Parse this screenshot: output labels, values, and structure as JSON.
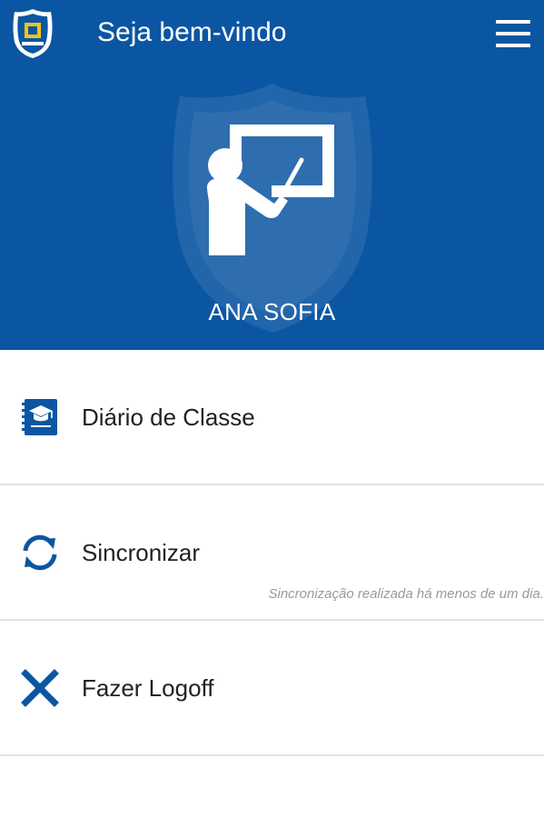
{
  "header": {
    "title": "Seja bem-vindo",
    "logo_icon": "school-shield-logo-icon",
    "menu_icon": "hamburger-menu-icon"
  },
  "profile": {
    "name": "ANA SOFIA",
    "avatar_icon": "teacher-at-board-icon",
    "watermark_icon": "shield-watermark-icon"
  },
  "menu": {
    "items": [
      {
        "label": "Diário de Classe",
        "icon": "class-diary-book-icon"
      },
      {
        "label": "Sincronizar",
        "icon": "sync-icon",
        "subtitle": "Sincronização realizada há menos de um dia."
      },
      {
        "label": "Fazer Logoff",
        "icon": "close-x-icon"
      }
    ]
  },
  "colors": {
    "primary": "#0b56a3",
    "icon": "#0b56a3",
    "divider": "#e3e3e3",
    "text": "#222222",
    "subtext": "#9a9a9a",
    "logo_accent": "#f2c418"
  }
}
